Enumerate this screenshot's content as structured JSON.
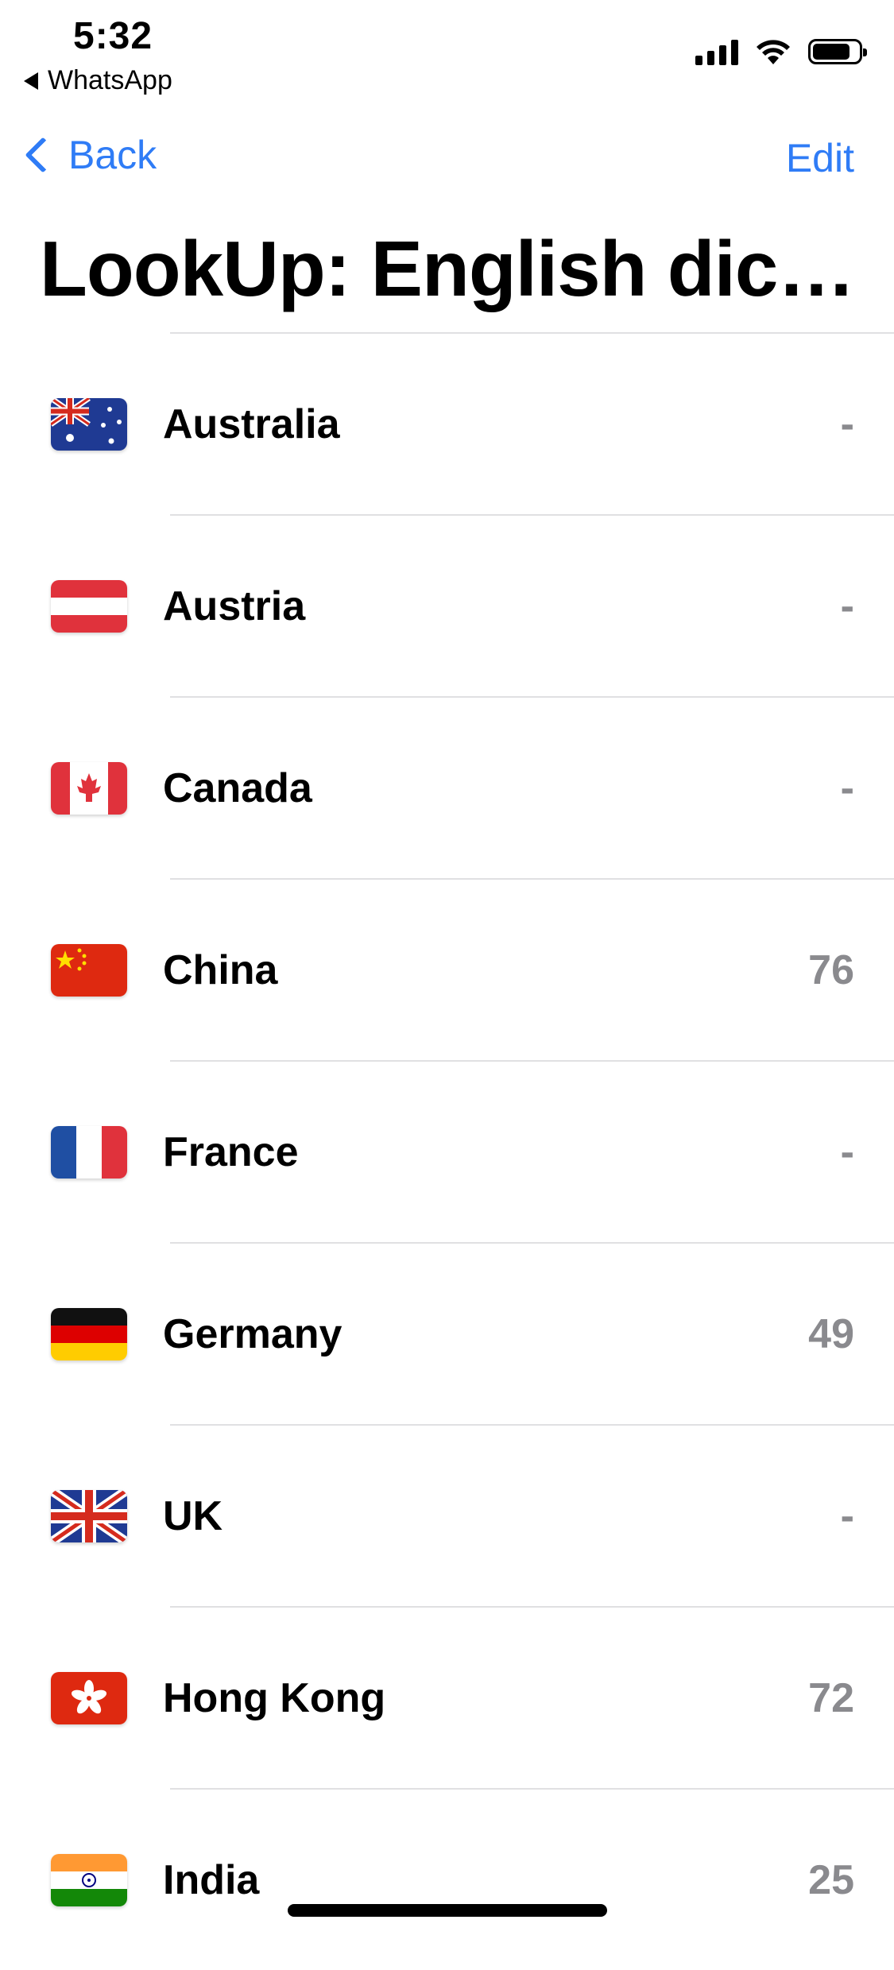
{
  "status_bar": {
    "time": "5:32",
    "back_app": "WhatsApp",
    "icons": [
      "signal-icon",
      "wifi-icon",
      "battery-icon"
    ]
  },
  "nav": {
    "back_label": "Back",
    "edit_label": "Edit",
    "title": "LookUp: English dict..."
  },
  "colors": {
    "accent": "#2f7cf6",
    "secondary_text": "#8a8a8e",
    "separator": "#e0e0e2"
  },
  "rows": [
    {
      "country": "Australia",
      "value": "-",
      "flag": "australia-flag-icon"
    },
    {
      "country": "Austria",
      "value": "-",
      "flag": "austria-flag-icon"
    },
    {
      "country": "Canada",
      "value": "-",
      "flag": "canada-flag-icon"
    },
    {
      "country": "China",
      "value": "76",
      "flag": "china-flag-icon"
    },
    {
      "country": "France",
      "value": "-",
      "flag": "france-flag-icon"
    },
    {
      "country": "Germany",
      "value": "49",
      "flag": "germany-flag-icon"
    },
    {
      "country": "UK",
      "value": "-",
      "flag": "uk-flag-icon"
    },
    {
      "country": "Hong Kong",
      "value": "72",
      "flag": "hong-kong-flag-icon"
    },
    {
      "country": "India",
      "value": "25",
      "flag": "india-flag-icon"
    }
  ]
}
